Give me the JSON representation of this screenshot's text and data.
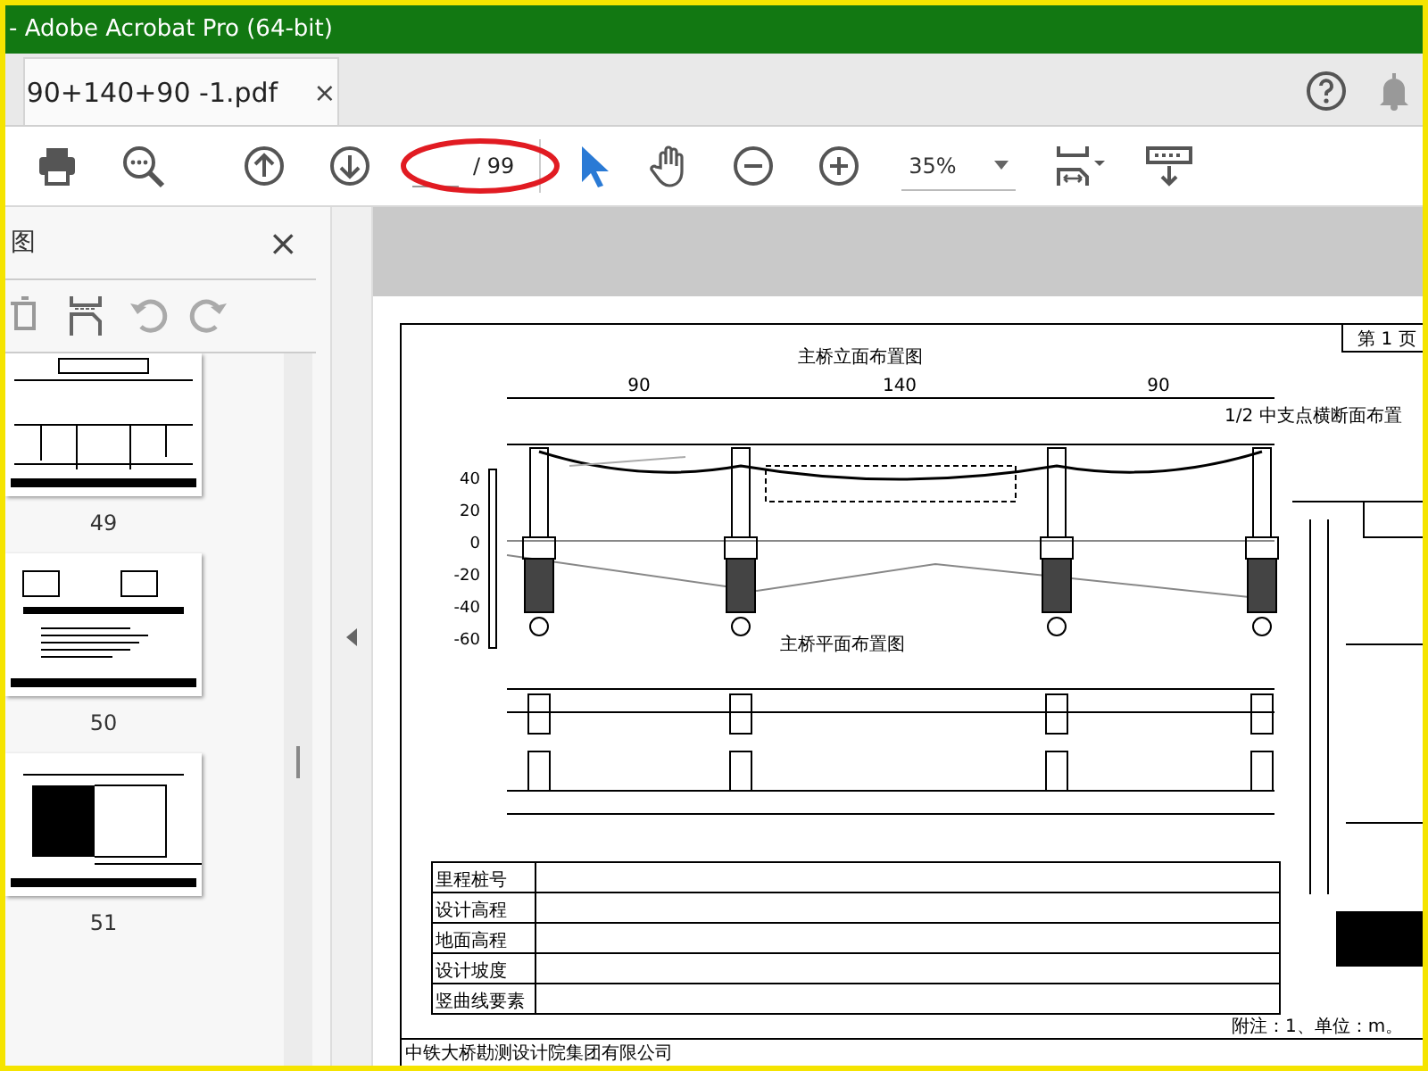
{
  "window": {
    "title": "- Adobe Acrobat Pro (64-bit)"
  },
  "tabs": [
    {
      "label": "90+140+90 -1.pdf",
      "selected": true,
      "close": "×"
    }
  ],
  "header_icons": [
    {
      "kind": "help"
    },
    {
      "kind": "bell"
    }
  ],
  "toolbar": [
    {
      "kind": "print"
    },
    {
      "kind": "find"
    },
    {
      "kind": "prev"
    },
    {
      "kind": "next"
    },
    {
      "kind": "page",
      "total": "/ 99"
    },
    {
      "kind": "select",
      "selected": true
    },
    {
      "kind": "hand",
      "selected": false
    },
    {
      "kind": "zoom_out"
    },
    {
      "kind": "zoom_in"
    },
    {
      "kind": "zoom",
      "value": "35%"
    },
    {
      "kind": "fit"
    },
    {
      "kind": "scroll"
    }
  ],
  "markup": {
    "kind": "ellipse"
  },
  "sidebar": {
    "title": "图",
    "close": "×",
    "tools": [
      {
        "kind": "delete"
      },
      {
        "kind": "insert"
      },
      {
        "kind": "rotate_ccw"
      },
      {
        "kind": "rotate_cw"
      }
    ],
    "thumbnails": [
      {
        "page": "49",
        "kind": "elevation"
      },
      {
        "page": "50",
        "kind": "notes"
      },
      {
        "page": "51",
        "kind": "section"
      }
    ]
  },
  "document": {
    "title": "主桥立面布置图",
    "plan_title": "主桥平面布置图",
    "page_label": "第 1 页",
    "section_title": "1/2 中支点横断面布置",
    "spans": [
      "90",
      "140",
      "90"
    ],
    "elevations": [
      "40",
      "20",
      "0",
      "-20",
      "-40",
      "-60"
    ],
    "profile_rows": [
      "里程桩号",
      "设计高程",
      "地面高程",
      "设计坡度",
      "竖曲线要素"
    ],
    "notes": "附注：1、单位：m。",
    "company": "中铁大桥勘测设计院集团有限公司"
  }
}
